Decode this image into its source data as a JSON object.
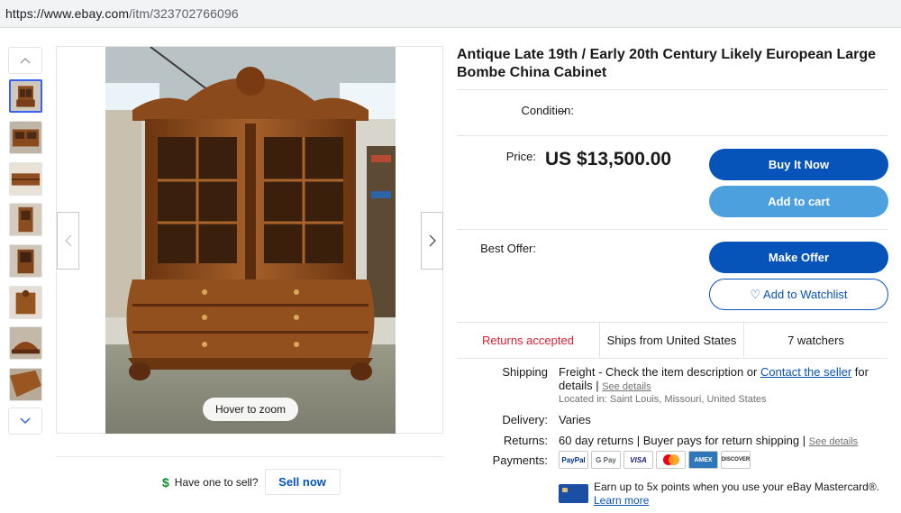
{
  "browser": {
    "url_host": "https://www.ebay.com",
    "url_path": "/itm/323702766096"
  },
  "gallery": {
    "zoom_hint": "Hover to zoom",
    "thumbnail_count": 8,
    "selected_index": 0
  },
  "sell": {
    "question": "Have one to sell?",
    "button": "Sell now"
  },
  "item": {
    "title": "Antique Late 19th / Early 20th Century Likely European Large Bombe China Cabinet",
    "condition_label": "Condition:",
    "condition_value": "--",
    "price_label": "Price:",
    "price_value": "US $13,500.00",
    "best_offer_label": "Best Offer:"
  },
  "actions": {
    "buy_now": "Buy It Now",
    "add_to_cart": "Add to cart",
    "make_offer": "Make Offer",
    "watchlist": "Add to Watchlist"
  },
  "trust": {
    "returns": "Returns accepted",
    "ships_from": "Ships from United States",
    "watchers": "7 watchers"
  },
  "details": {
    "shipping_label": "Shipping",
    "shipping_text": "Freight - Check the item description or",
    "contact_seller": "Contact the seller",
    "shipping_for": "for",
    "shipping_details_word": "details |",
    "see_details_1": "See details",
    "location": "Located in: Saint Louis, Missouri, United States",
    "delivery_label": "Delivery:",
    "delivery_value": "Varies",
    "returns_label": "Returns:",
    "returns_value": "60 day returns | Buyer pays for return shipping |",
    "see_details_2": "See details",
    "payments_label": "Payments:",
    "payment_methods": [
      "PayPal",
      "G Pay",
      "VISA",
      "Mastercard",
      "AMEX",
      "DISCOVER"
    ],
    "mastercard_line1": "Earn up to 5x points when you use your eBay Mastercard®.",
    "learn_more": "Learn more"
  },
  "colors": {
    "primary_blue": "#0654ba",
    "secondary_blue": "#4ca0dd",
    "link_blue": "#0654ba",
    "returns_red": "#dd1e31",
    "selected_thumb_border": "#3665f3"
  }
}
